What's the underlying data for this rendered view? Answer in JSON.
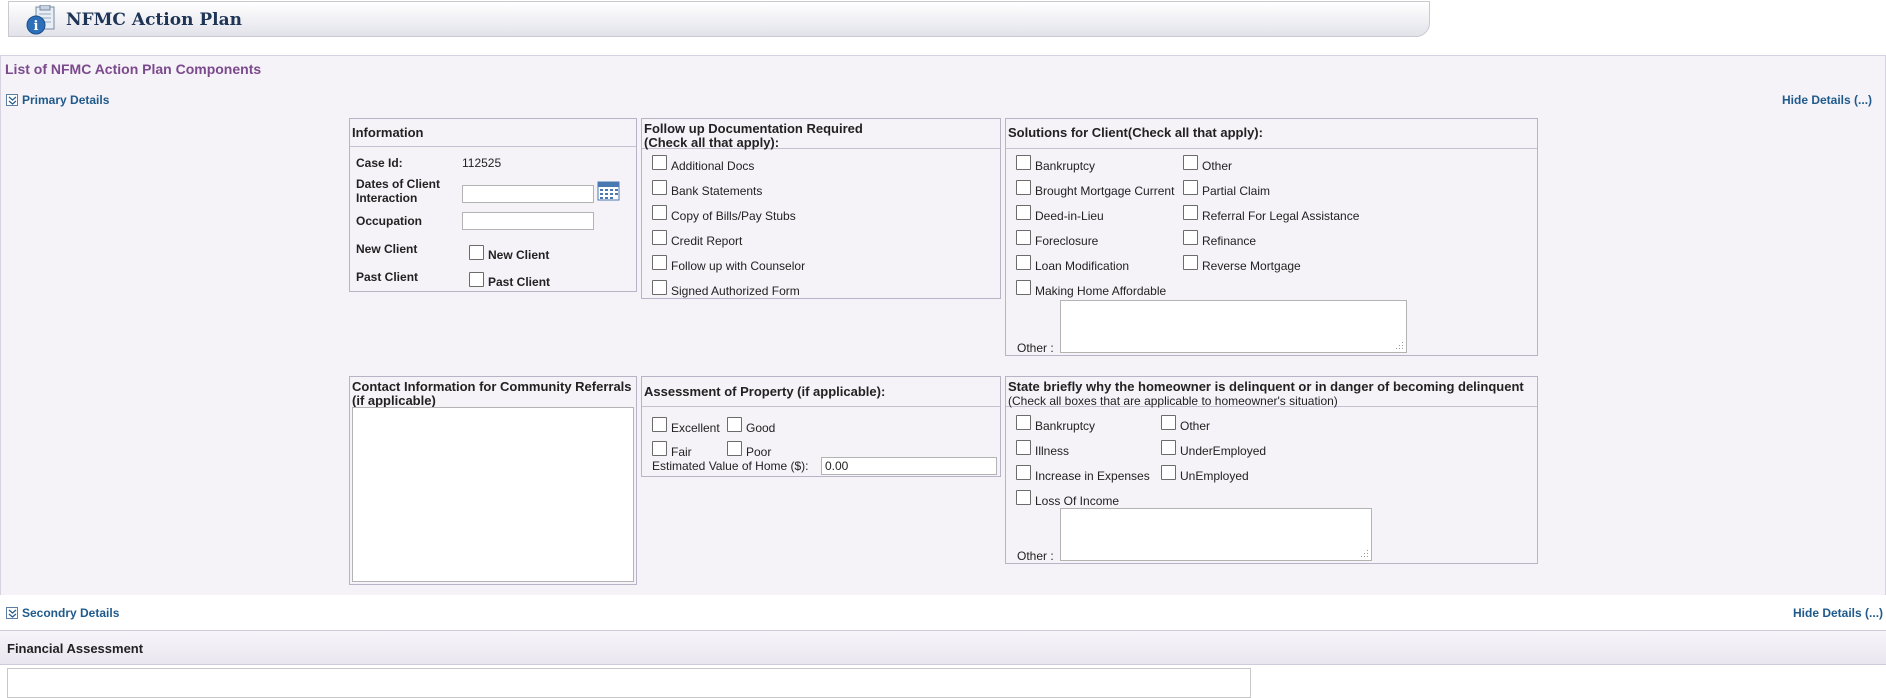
{
  "page": {
    "title": "NFMC Action Plan"
  },
  "list_title": "List of NFMC Action Plan Components",
  "primary": {
    "label": "Primary Details",
    "hide_label": "Hide Details (...)"
  },
  "secondary": {
    "label": "Secondry Details",
    "hide_label": "Hide Details (...)"
  },
  "information": {
    "heading": "Information",
    "case_id_label": "Case Id:",
    "case_id_value": "112525",
    "dates_label_1": "Dates of Client",
    "dates_label_2": "Interaction",
    "dates_value": "",
    "occupation_label": "Occupation",
    "occupation_value": "",
    "new_client_label": "New Client",
    "new_client_cb": "New Client",
    "past_client_label": "Past Client",
    "past_client_cb": "Past Client"
  },
  "followup": {
    "heading_1": "Follow up Documentation Required",
    "heading_2": "(Check all that apply):",
    "items": [
      "Additional Docs",
      "Bank Statements",
      "Copy of Bills/Pay Stubs",
      "Credit Report",
      "Follow up with Counselor",
      "Signed Authorized Form"
    ]
  },
  "solutions": {
    "heading": "Solutions for Client(Check all that apply):",
    "col1": [
      "Bankruptcy",
      "Brought Mortgage Current",
      "Deed-in-Lieu",
      "Foreclosure",
      "Loan Modification",
      "Making Home Affordable"
    ],
    "col2": [
      "Other",
      "Partial Claim",
      "Referral For Legal Assistance",
      "Refinance",
      "Reverse Mortgage"
    ],
    "other_label": "Other :",
    "other_value": ""
  },
  "contact": {
    "heading_1": "Contact Information for Community Referrals",
    "heading_2": "(if applicable)",
    "value": ""
  },
  "assessment": {
    "heading": "Assessment of Property (if applicable):",
    "options": [
      "Excellent",
      "Good",
      "Fair",
      "Poor"
    ],
    "estimated_label": "Estimated Value of Home ($):",
    "estimated_value": "0.00"
  },
  "delinquent": {
    "heading": "State briefly why the homeowner is delinquent or in danger of becoming delinquent",
    "subheading": "(Check all boxes that are applicable to homeowner's situation)",
    "col1": [
      "Bankruptcy",
      "Illness",
      "Increase in Expenses",
      "Loss Of Income"
    ],
    "col2": [
      "Other",
      "UnderEmployed",
      "UnEmployed"
    ],
    "other_label": "Other :",
    "other_value": ""
  },
  "financial": {
    "heading": "Financial Assessment"
  },
  "icons": {
    "header": "info-document-icon",
    "calendar": "calendar-icon",
    "toggle": "double-chevron-down-icon"
  },
  "colors": {
    "title": "#1e3556",
    "accent_purple": "#7a4a8c",
    "link_blue": "#1f5a8c",
    "panel_bg": "#f5f2f8"
  }
}
